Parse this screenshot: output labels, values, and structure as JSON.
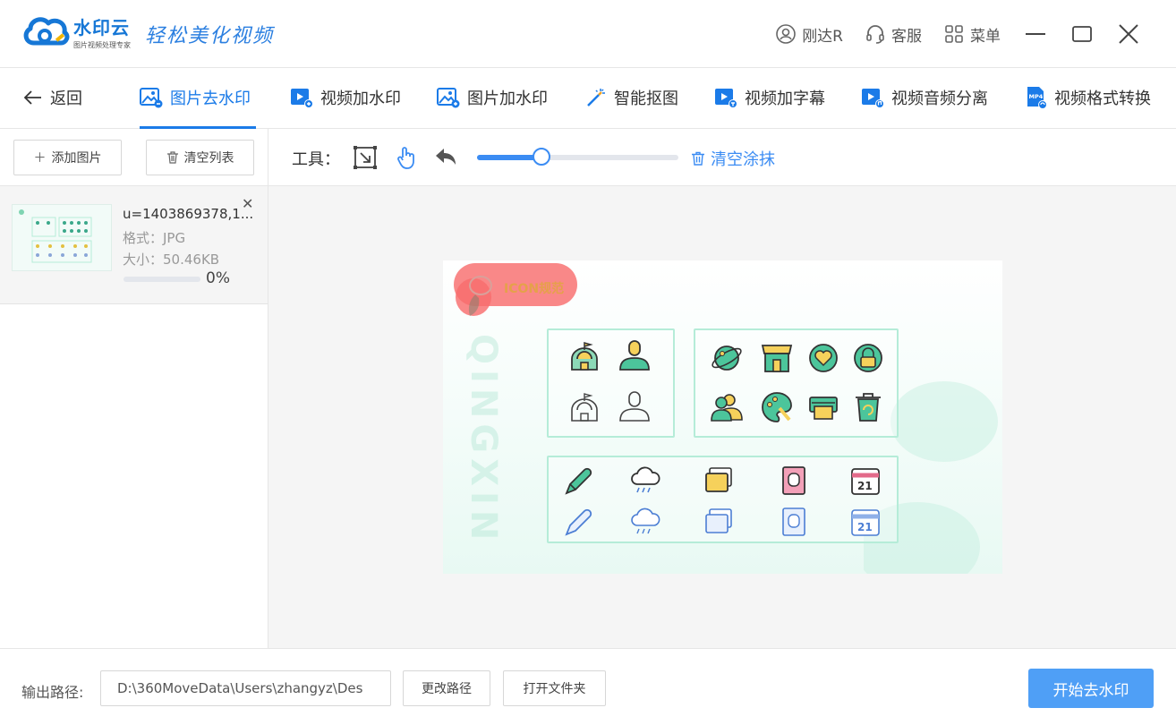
{
  "app": {
    "name": "水印云",
    "subtitle": "图片视频处理专家",
    "slogan": "轻松美化视频"
  },
  "titlebar": {
    "user": "刚达R",
    "service": "客服",
    "menu": "菜单"
  },
  "nav": {
    "back": "返回",
    "tabs": [
      {
        "label": "图片去水印",
        "active": true
      },
      {
        "label": "视频加水印"
      },
      {
        "label": "图片加水印"
      },
      {
        "label": "智能抠图"
      },
      {
        "label": "视频加字幕"
      },
      {
        "label": "视频音频分离"
      },
      {
        "label": "视频格式转换"
      }
    ],
    "mp4_badge": "MP4"
  },
  "left": {
    "add_label": "添加图片",
    "clear_label": "清空列表",
    "file": {
      "name": "u=1403869378,1...",
      "format": "格式：JPG",
      "size": "大小：50.46KB",
      "progress": 0,
      "progress_text": "0%"
    }
  },
  "tools": {
    "label": "工具：",
    "brush_size": 0.32,
    "clear_label": "清空涂抹"
  },
  "preview": {
    "mask_text": "ICON规范",
    "watermark_text": "QINGXIN",
    "calendar_day": "21",
    "accent": "#b5ecd8"
  },
  "footer": {
    "output_label": "输出路径:",
    "output_path": "D:\\360MoveData\\Users\\zhangyz\\Des",
    "change_path": "更改路径",
    "open_folder": "打开文件夹",
    "start": "开始去水印"
  },
  "colors": {
    "primary": "#1b7be8",
    "button": "#4f9ff6",
    "mask": "#f86e6e"
  }
}
